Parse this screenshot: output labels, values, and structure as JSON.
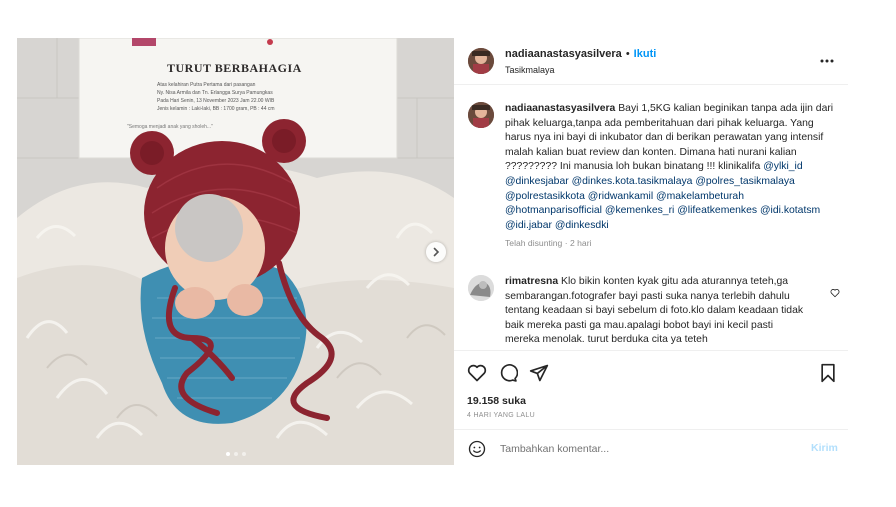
{
  "post": {
    "username": "nadiaanastasyasilvera",
    "separator": "•",
    "follow_label": "Ikuti",
    "location": "Tasikmalaya",
    "more_icon": "more-horizontal-icon"
  },
  "photo": {
    "sign_title": "TURUT BERBAHAGIA",
    "sign_line1": "Atas kelahiran Putra Pertama dari pasangan",
    "sign_line2": "Ny. Nisa Armila dan Tn. Erlangga Surya Pamungkas",
    "sign_line3": "Pada Hari Senin, 13 November 2023 Jam 22.00 WIB",
    "sign_line4": "Jenis kelamin : Laki-laki, BB : 1700 gram, PB : 44 cm",
    "sign_line5": "\"Semoga menjadi anak yang sholeh...\"",
    "carousel_count": 3,
    "carousel_active_index": 0
  },
  "caption": {
    "username": "nadiaanastasyasilvera",
    "text": "Bayi 1,5KG kalian beginikan tanpa ada ijin dari pihak keluarga,tanpa ada pemberitahuan dari pihak keluarga. Yang harus nya ini bayi di inkubator dan di berikan perawatan yang intensif malah kalian buat review dan konten. Dimana hati nurani kalian ????????? Ini manusia loh bukan binatang !!! klinikalifa",
    "mentions": [
      "@ylki_id",
      "@dinkesjabar",
      "@dinkes.kota.tasikmalaya",
      "@polres_tasikmalaya",
      "@polrestasikkota",
      "@ridwankamil",
      "@makelambeturah",
      "@hotmanparisofficial",
      "@kemenkes_ri",
      "@lifeatkemenkes",
      "@idi.kotatsm",
      "@idi.jabar",
      "@dinkesdki"
    ],
    "meta": "Telah disunting · 2 hari"
  },
  "comment": {
    "username": "rimatresna",
    "text": "Klo bikin konten kyak gitu ada aturannya teteh,ga sembarangan.fotografer bayi pasti suka nanya terlebih dahulu tentang keadaan si bayi sebelum di foto.klo dalam keadaan tidak baik mereka pasti ga mau.apalagi bobot bayi ini kecil pasti mereka menolak. turut berduka cita ya teteh"
  },
  "actions": {
    "likes": "19.158 suka",
    "time": "4 HARI YANG LALU"
  },
  "composer": {
    "placeholder": "Tambahkan komentar...",
    "send_label": "Kirim"
  },
  "colors": {
    "link": "#0095f6",
    "mention": "#00376b",
    "muted": "#8e8e8e",
    "send_disabled": "#b2dffc"
  }
}
